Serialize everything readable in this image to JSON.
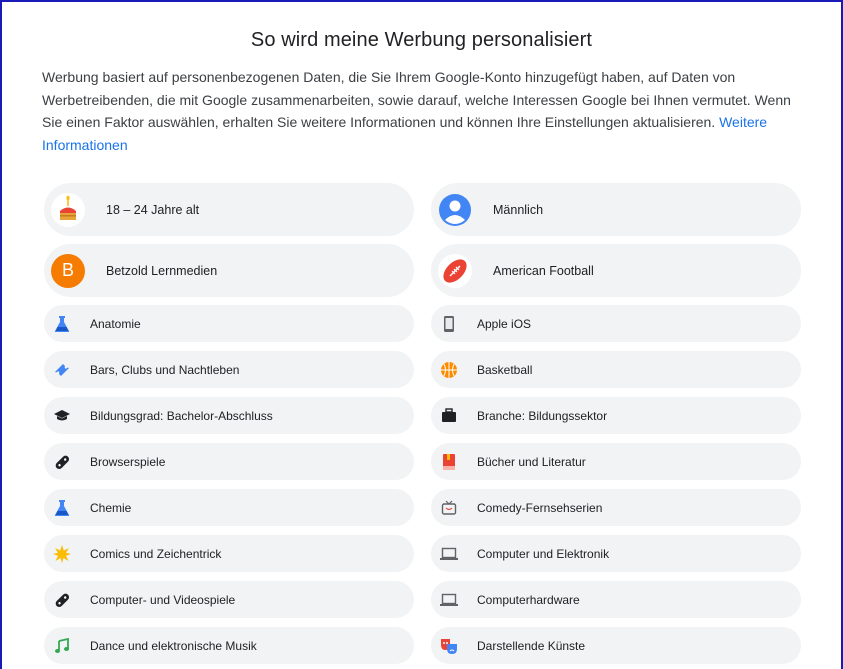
{
  "header": {
    "title": "So wird meine Werbung personalisiert"
  },
  "description": {
    "text": "Werbung basiert auf personenbezogenen Daten, die Sie Ihrem Google-Konto hinzugefügt haben, auf Daten von Werbetreibenden, die mit Google zusammenarbeiten, sowie darauf, welche Interessen Google bei Ihnen vermutet. Wenn Sie einen Faktor auswählen, erhalten Sie weitere Informationen und können Ihre Einstellungen aktualisieren. ",
    "link": "Weitere Informationen"
  },
  "factors": {
    "age": {
      "label": "18 – 24 Jahre alt",
      "icon": "birthday-cake-icon"
    },
    "gender": {
      "label": "Männlich",
      "icon": "person-avatar-icon"
    },
    "advertiser": {
      "label": "Betzold Lernmedien",
      "letter": "B",
      "icon": "advertiser-avatar"
    },
    "american_football": {
      "label": "American Football",
      "icon": "football-icon"
    }
  },
  "topics": [
    {
      "label": "Anatomie",
      "icon": "flask-icon"
    },
    {
      "label": "Apple iOS",
      "icon": "phone-icon"
    },
    {
      "label": "Bars, Clubs und Nachtleben",
      "icon": "ticket-icon"
    },
    {
      "label": "Basketball",
      "icon": "basketball-icon"
    },
    {
      "label": "Bildungsgrad: Bachelor-Abschluss",
      "icon": "graduation-cap-icon"
    },
    {
      "label": "Branche: Bildungssektor",
      "icon": "briefcase-icon"
    },
    {
      "label": "Browserspiele",
      "icon": "gamepad-icon"
    },
    {
      "label": "Bücher und Literatur",
      "icon": "book-icon"
    },
    {
      "label": "Chemie",
      "icon": "flask-icon"
    },
    {
      "label": "Comedy-Fernsehserien",
      "icon": "tv-icon"
    },
    {
      "label": "Comics und Zeichentrick",
      "icon": "burst-star-icon"
    },
    {
      "label": "Computer und Elektronik",
      "icon": "laptop-icon"
    },
    {
      "label": "Computer- und Videospiele",
      "icon": "gamepad-icon"
    },
    {
      "label": "Computerhardware",
      "icon": "laptop-icon"
    },
    {
      "label": "Dance und elektronische Musik",
      "icon": "music-note-icon"
    },
    {
      "label": "Darstellende Künste",
      "icon": "theater-masks-icon"
    }
  ]
}
